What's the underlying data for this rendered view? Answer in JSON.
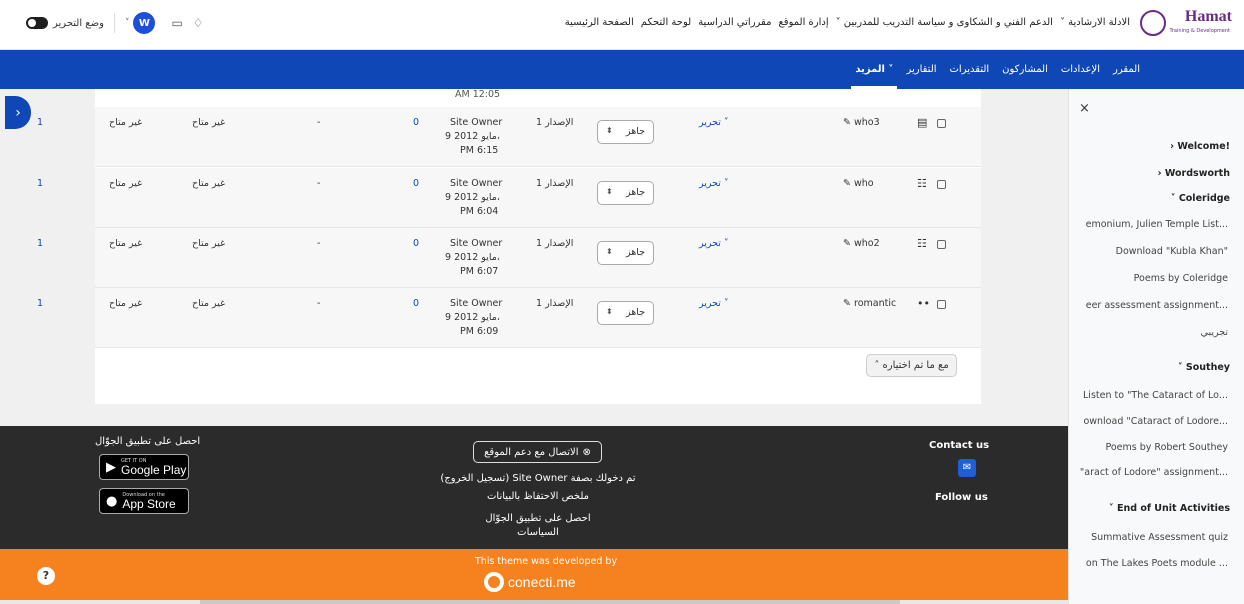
{
  "brand": {
    "name": "Hamat",
    "tagline": "Training & Development"
  },
  "topnav": [
    "الصفحة الرئيسية",
    "لوحة التحكم",
    "مقرراتي الدراسية",
    "إدارة الموقع",
    "الدعم الفني و الشكاوى و سياسة التدريب للمدربين ˅",
    "الادلة الارشادية ˅"
  ],
  "user": {
    "initial": "W",
    "edit_mode_label": "وضع التحرير"
  },
  "subnav": [
    "المقرر",
    "الإعدادات",
    "المشاركون",
    "التقديرات",
    "التقارير",
    "المزيد ˅"
  ],
  "drawer": {
    "items": [
      {
        "label": "!Welcome  ‹",
        "type": "bold"
      },
      {
        "label": "Wordsworth  ‹",
        "type": "bold"
      },
      {
        "label": "Coleridge  ˅",
        "type": "bold"
      },
      {
        "label": "...emonium, Julien Temple List",
        "type": "sub"
      },
      {
        "label": "\"Download \"Kubla Khan",
        "type": "sub"
      },
      {
        "label": "Poems by Coleridge",
        "type": "sub"
      },
      {
        "label": "...eer assessment assignment",
        "type": "sub"
      },
      {
        "label": "تجريبي",
        "type": "sub"
      },
      {
        "label": "Southey  ˅",
        "type": "bold"
      },
      {
        "label": "...Listen to \"The Cataract of Lo",
        "type": "sub"
      },
      {
        "label": "...ownload \"Cataract of Lodore",
        "type": "sub"
      },
      {
        "label": "Poems by Robert Southey",
        "type": "sub"
      },
      {
        "label": "...aract of Lodore\" assignment\"",
        "type": "sub"
      },
      {
        "label": "End of Unit Activities  ˅",
        "type": "bold"
      },
      {
        "label": "Summative Assessment quiz",
        "type": "sub"
      },
      {
        "label": "... on The Lakes Poets module",
        "type": "sub"
      }
    ]
  },
  "table": {
    "top_clip": "AM 12:05",
    "rows": [
      {
        "name": "who3",
        "edit": "تحرير ˅",
        "status": "جاهز",
        "version": "الإصدار 1",
        "owner": "Site Owner",
        "date": "9 مايو 2012،",
        "time": "PM 6:15",
        "count": "0",
        "dash": "-",
        "na1": "غير متاح",
        "na2": "غير متاح",
        "num": "1"
      },
      {
        "name": "who",
        "edit": "تحرير ˅",
        "status": "جاهز",
        "version": "الإصدار 1",
        "owner": "Site Owner",
        "date": "9 مايو 2012،",
        "time": "PM 6:04",
        "count": "0",
        "dash": "-",
        "na1": "غير متاح",
        "na2": "غير متاح",
        "num": "1"
      },
      {
        "name": "who2",
        "edit": "تحرير ˅",
        "status": "جاهز",
        "version": "الإصدار 1",
        "owner": "Site Owner",
        "date": "9 مايو 2012،",
        "time": "PM 6:07",
        "count": "0",
        "dash": "-",
        "na1": "غير متاح",
        "na2": "غير متاح",
        "num": "1"
      },
      {
        "name": "romantic",
        "edit": "تحرير ˅",
        "status": "جاهز",
        "version": "الإصدار 1",
        "owner": "Site Owner",
        "date": "9 مايو 2012،",
        "time": "PM 6:09",
        "count": "0",
        "dash": "-",
        "na1": "غير متاح",
        "na2": "غير متاح",
        "num": "1"
      }
    ],
    "bulk_label": "مع ما تم اختياره ˄"
  },
  "footer": {
    "contact_us": "Contact us",
    "follow_us": "Follow us",
    "support_btn": "الاتصال مع دعم الموقع",
    "logged_in": "تم دخولك بصفة Site Owner (تسجيل الخروج)",
    "data_retention": "ملخص الاحتفاظ بالبيانات",
    "get_app": "احصل على تطبيق الجوّال",
    "policies": "السياسات",
    "app_title": "احصل على تطبيق الجوّال",
    "google_small": "GET IT ON",
    "google_big": "Google Play",
    "apple_small": "Download on the",
    "apple_big": "App Store"
  },
  "theme": {
    "developed_by": "This theme was developed by",
    "brand": "conecti.me"
  },
  "colors": {
    "primary": "#0f47b6",
    "orange": "#f5821f",
    "footer": "#2b2b2b",
    "brand": "#6a2b86"
  }
}
